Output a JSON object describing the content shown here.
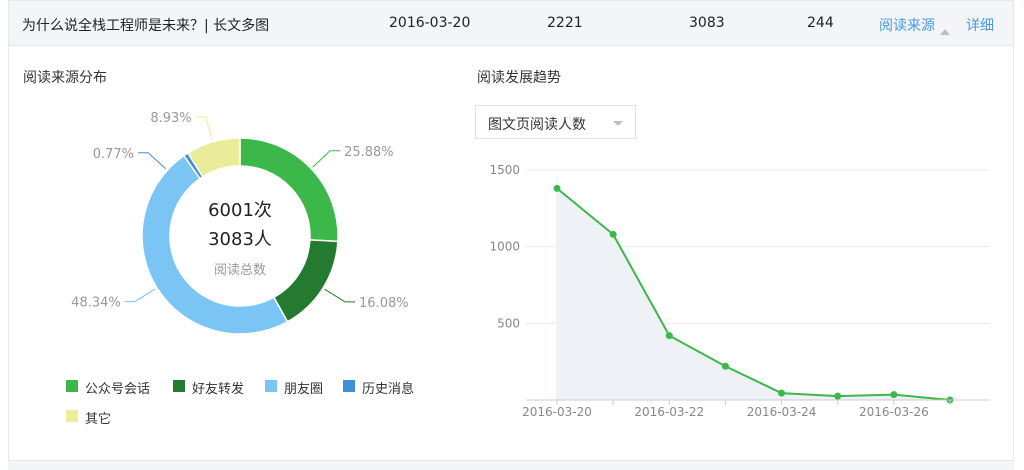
{
  "article_row": {
    "title": "为什么说全栈工程师是未来？| 长文多图",
    "date": "2016-03-20",
    "value1": "2221",
    "value2": "3083",
    "value3": "244",
    "source_link": "阅读来源",
    "detail_link": "详细"
  },
  "source_section": {
    "title": "阅读来源分布",
    "center_line1": "6001次",
    "center_line2": "3083人",
    "center_caption": "阅读总数",
    "legend": [
      {
        "label": "公众号会话",
        "color": "#3cb84a"
      },
      {
        "label": "好友转发",
        "color": "#247a2e"
      },
      {
        "label": "朋友圈",
        "color": "#7ac5f3"
      },
      {
        "label": "历史消息",
        "color": "#3f8fd9"
      },
      {
        "label": "其它",
        "color": "#eaec9a"
      }
    ]
  },
  "trend_section": {
    "title": "阅读发展趋势",
    "dropdown_value": "图文页阅读人数"
  },
  "chart_data": [
    {
      "type": "pie",
      "donut": true,
      "categories": [
        "公众号会话",
        "好友转发",
        "朋友圈",
        "历史消息",
        "其它"
      ],
      "values": [
        25.88,
        16.08,
        48.34,
        0.77,
        8.93
      ],
      "value_labels": [
        "25.88%",
        "16.08%",
        "48.34%",
        "0.77%",
        "8.93%"
      ],
      "colors": [
        "#3cb84a",
        "#247a2e",
        "#7ac5f3",
        "#3f8fd9",
        "#eaec9a"
      ]
    },
    {
      "type": "area",
      "x": [
        "2016-03-20",
        "2016-03-21",
        "2016-03-22",
        "2016-03-23",
        "2016-03-24",
        "2016-03-25",
        "2016-03-26",
        "2016-03-27"
      ],
      "x_tick_labels": [
        "2016-03-20",
        "2016-03-22",
        "2016-03-24",
        "2016-03-26"
      ],
      "y": [
        1380,
        1080,
        420,
        220,
        45,
        25,
        35,
        0
      ],
      "yticks": [
        500,
        1000,
        1500
      ],
      "ylim": [
        0,
        1500
      ],
      "color": "#3cb84a",
      "fill": "#eef1f6",
      "grid": true
    }
  ]
}
